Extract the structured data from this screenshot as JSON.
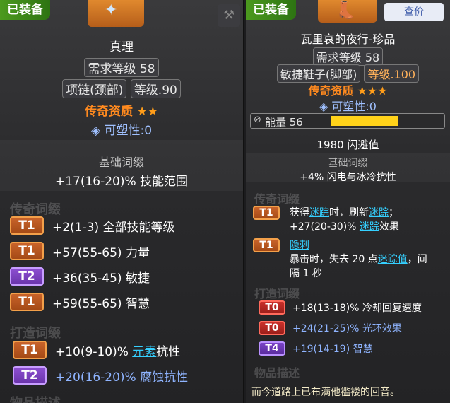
{
  "left": {
    "equipped": "已装备",
    "name": "真理",
    "req_level": "需求等级 58",
    "slot": "项链(颈部)",
    "item_level": "等级.90",
    "quality": "传奇资质",
    "stars": "★★",
    "plasticity": "可塑性:0",
    "base_header": "基础词缀",
    "base_affix": "+17(16-20)% 技能范围",
    "legend_header": "传奇词缀",
    "legend_affixes": [
      {
        "tier": "T1",
        "text": "+2(1-3) 全部技能等级"
      },
      {
        "tier": "T1",
        "text": "+57(55-65) 力量"
      },
      {
        "tier": "T2",
        "text": "+36(35-45) 敏捷"
      },
      {
        "tier": "T1",
        "text": "+59(55-65) 智慧"
      }
    ],
    "forge_header": "打造词缀",
    "forge_affixes": [
      {
        "tier": "T1",
        "pre": "+10(9-10)% ",
        "link": "元素",
        "post": "抗性"
      },
      {
        "tier": "T2",
        "text": "+20(16-20)% 腐蚀抗性"
      }
    ],
    "desc_header": "物品描述"
  },
  "right": {
    "equipped": "已装备",
    "price_button": "查价",
    "name": "瓦里哀的夜行-珍品",
    "req_level": "需求等级 58",
    "slot": "敏捷鞋子(脚部)",
    "item_level": "等级.100",
    "quality": "传奇资质",
    "stars": "★★★",
    "plasticity": "可塑性:0",
    "energy_label": "能量 56",
    "energy_fraction": 0.6,
    "implicit": "1980 闪避值",
    "base_header": "基础词缀",
    "base_affix": "+4% 闪电与冰冷抗性",
    "legend_header": "传奇词缀",
    "legend1": {
      "tier": "T1",
      "line1_a": "获得",
      "line1_link1": "迷踪",
      "line1_b": "时，刷新",
      "line1_link2": "迷踪",
      "line1_c": "；",
      "line2_a": "+27(20-30)% ",
      "line2_link": "迷踪",
      "line2_b": "效果"
    },
    "legend2": {
      "tier": "T1",
      "title": "隐刺",
      "line1_a": "暴击时，失去 20 点",
      "line1_link": "迷踪值",
      "line1_b": "，间",
      "line2": "隔 1 秒"
    },
    "forge_header": "打造词缀",
    "forge_affixes": [
      {
        "tier": "T0",
        "text": "+18(13-18)% 冷却回复速度"
      },
      {
        "tier": "T0",
        "text": "+24(21-25)% 光环效果"
      },
      {
        "tier": "T4",
        "text": "+19(14-19) 智慧"
      }
    ],
    "desc_header": "物品描述",
    "flavor": "而今道路上已布满他褴褛的回音。"
  }
}
